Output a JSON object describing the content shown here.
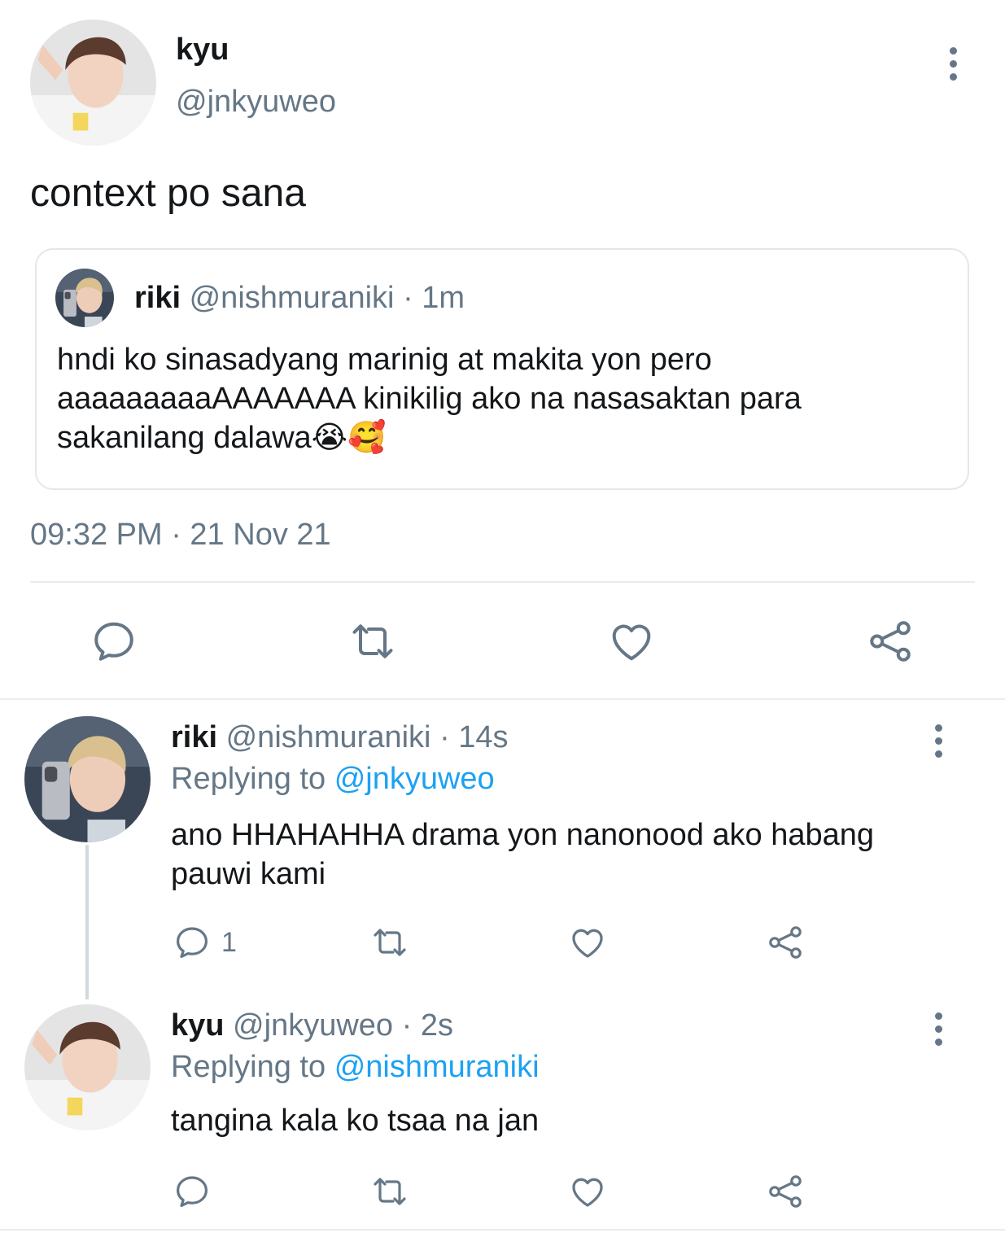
{
  "main_tweet": {
    "display_name": "kyu",
    "handle": "@jnkyuweo",
    "text": "context po sana",
    "timestamp": "09:32 PM · 21 Nov 21",
    "quoted": {
      "display_name": "riki",
      "handle": "@nishmuraniki",
      "time": "· 1m",
      "line1": "hndi ko sinasadyang marinig at makita yon pero",
      "line2": "aaaaaaaaaAAAAAAA kinikilig ako na nasasaktan para",
      "line3": "sakanilang dalawa",
      "emoji": "😭🥰"
    }
  },
  "replies": [
    {
      "display_name": "riki",
      "handle": "@nishmuraniki",
      "time": "· 14s",
      "replying_label": "Replying to",
      "replying_handle": "@jnkyuweo",
      "line1": "ano HHAHAHHA drama yon nanonood ako habang",
      "line2": "pauwi kami",
      "reply_count": "1"
    },
    {
      "display_name": "kyu",
      "handle": "@jnkyuweo",
      "time": "· 2s",
      "replying_label": "Replying to",
      "replying_handle": "@nishmuraniki",
      "line1": "tangina kala ko tsaa na jan",
      "reply_count": ""
    }
  ],
  "icons": {
    "reply": "reply-icon",
    "retweet": "retweet-icon",
    "like": "heart-icon",
    "share": "share-icon",
    "more": "more-vertical-icon"
  },
  "colors": {
    "text": "#14171a",
    "muted": "#657786",
    "link": "#1da1f2",
    "border": "#e1e8ed"
  }
}
